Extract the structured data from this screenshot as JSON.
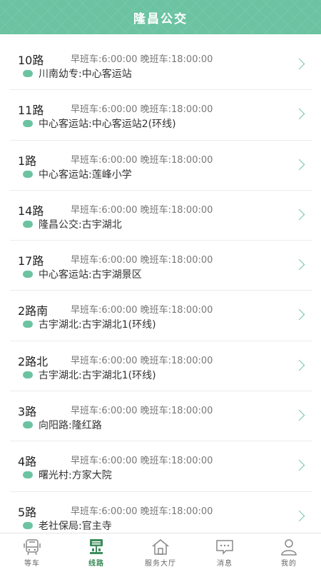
{
  "header": {
    "title": "隆昌公交"
  },
  "routes": [
    {
      "name": "10路",
      "times": "早班车:6:00:00 晚班车:18:00:00",
      "stops": "川南幼专:中心客运站"
    },
    {
      "name": "11路",
      "times": "早班车:6:00:00 晚班车:18:00:00",
      "stops": "中心客运站:中心客运站2(环线)"
    },
    {
      "name": "1路",
      "times": "早班车:6:00:00 晚班车:18:00:00",
      "stops": "中心客运站:莲峰小学"
    },
    {
      "name": "14路",
      "times": "早班车:6:00:00 晚班车:18:00:00",
      "stops": "隆昌公交:古宇湖北"
    },
    {
      "name": "17路",
      "times": "早班车:6:00:00 晚班车:18:00:00",
      "stops": "中心客运站:古宇湖景区"
    },
    {
      "name": "2路南",
      "times": "早班车:6:00:00 晚班车:18:00:00",
      "stops": "古宇湖北:古宇湖北1(环线)"
    },
    {
      "name": "2路北",
      "times": "早班车:6:00:00 晚班车:18:00:00",
      "stops": "古宇湖北:古宇湖北1(环线)"
    },
    {
      "name": "3路",
      "times": "早班车:6:00:00 晚班车:18:00:00",
      "stops": "向阳路:隆红路"
    },
    {
      "name": "4路",
      "times": "早班车:6:00:00 晚班车:18:00:00",
      "stops": "曙光村:方家大院"
    },
    {
      "name": "5路",
      "times": "早班车:6:00:00 晚班车:18:00:00",
      "stops": "老社保局:官主寺"
    }
  ],
  "tabbar": {
    "items": [
      {
        "label": "等车",
        "icon": "bus-icon"
      },
      {
        "label": "线路",
        "icon": "route-icon"
      },
      {
        "label": "服务大厅",
        "icon": "home-icon"
      },
      {
        "label": "消息",
        "icon": "message-icon"
      },
      {
        "label": "我的",
        "icon": "person-icon"
      }
    ],
    "active": "线路"
  },
  "colors": {
    "accent": "#6cc3a2",
    "active_tab": "#3d8c5c"
  }
}
